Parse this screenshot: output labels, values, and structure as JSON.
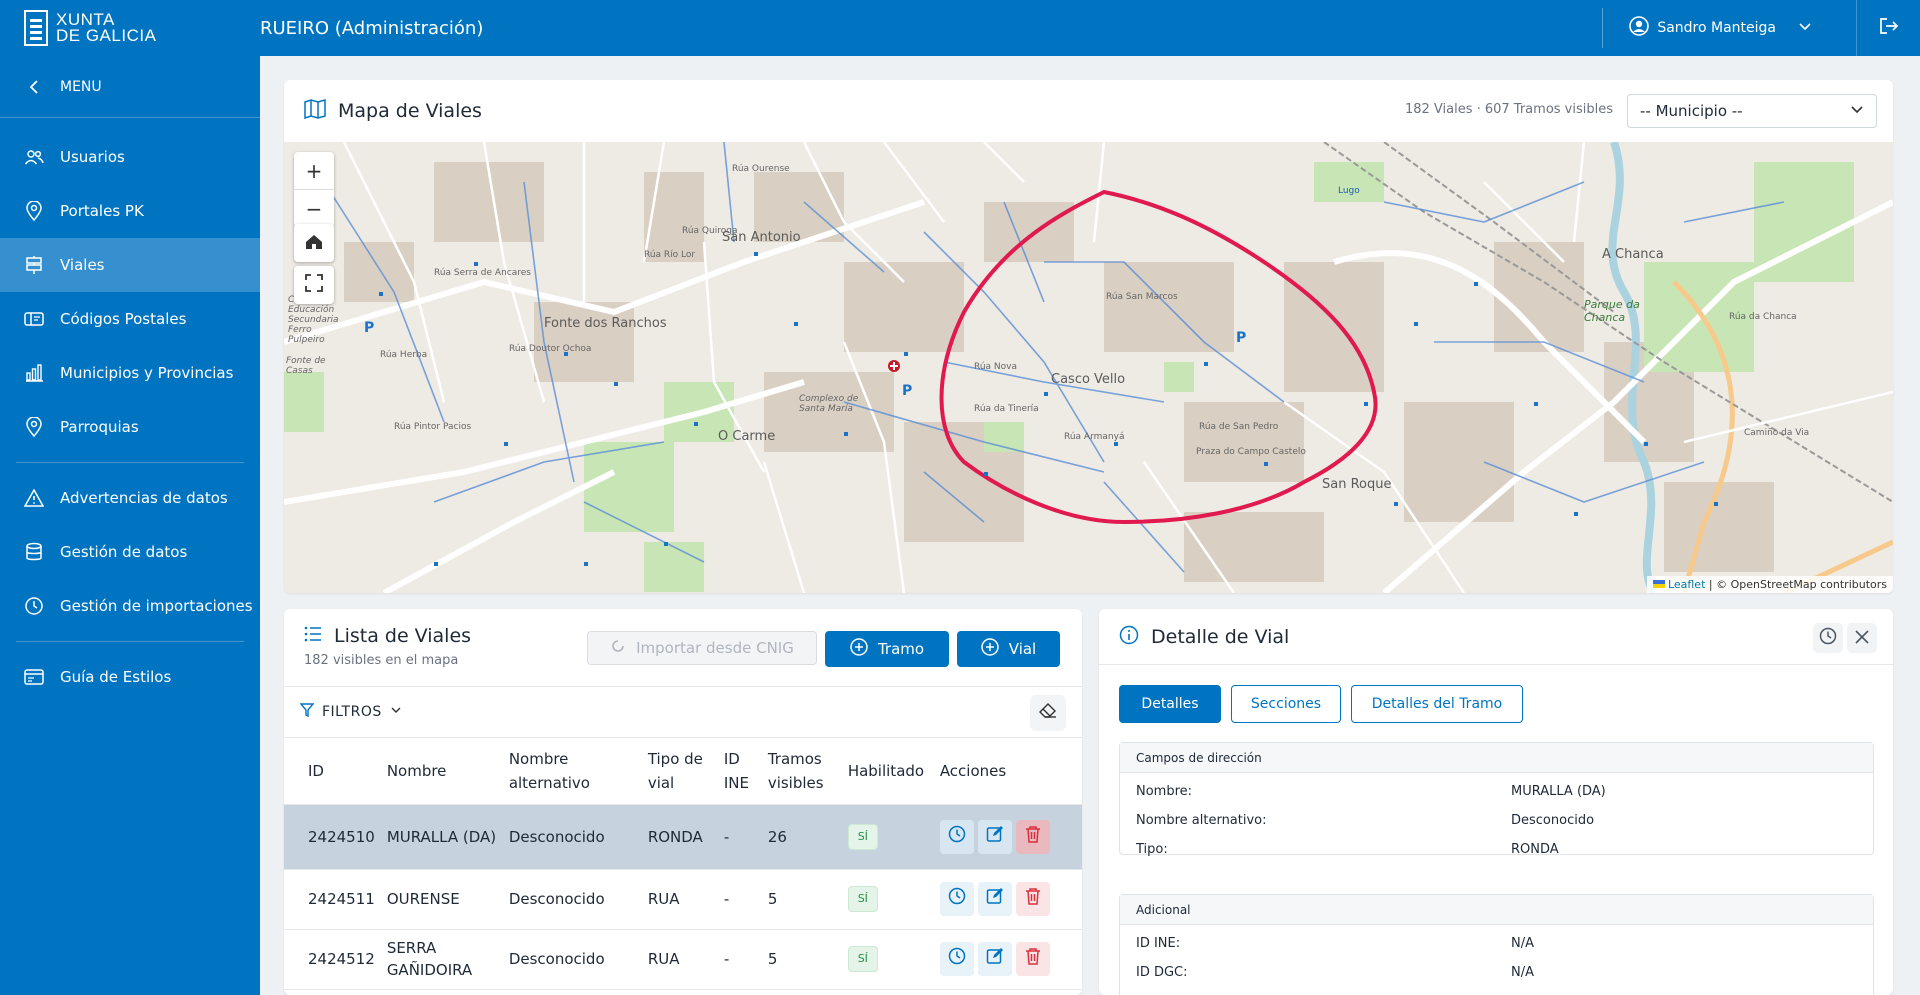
{
  "header": {
    "logo_line1": "XUNTA",
    "logo_line2": "DE GALICIA",
    "app_title": "RUEIRO (Administración)",
    "user_name": "Sandro Manteiga"
  },
  "sidebar": {
    "menu_label": "MENU",
    "items": [
      {
        "label": "Usuarios",
        "icon": "users-icon"
      },
      {
        "label": "Portales PK",
        "icon": "map-pin-icon"
      },
      {
        "label": "Viales",
        "icon": "signpost-icon"
      },
      {
        "label": "Códigos Postales",
        "icon": "mailbox-icon"
      },
      {
        "label": "Municipios y Provincias",
        "icon": "bar-chart-icon"
      },
      {
        "label": "Parroquias",
        "icon": "location-icon"
      },
      {
        "label": "Advertencias de datos",
        "icon": "warning-icon"
      },
      {
        "label": "Gestión de datos",
        "icon": "database-icon"
      },
      {
        "label": "Gestión de importaciones",
        "icon": "history-icon"
      },
      {
        "label": "Guía de Estilos",
        "icon": "browser-icon"
      }
    ],
    "active_item": "Viales"
  },
  "map_panel": {
    "title": "Mapa de Viales",
    "stats": "182 Viales · 607 Tramos visibles",
    "municipio_select": "-- Municipio --",
    "zoom_in": "+",
    "zoom_out": "−",
    "attribution_leaflet": "Leaflet",
    "attribution_rest": "| © OpenStreetMap contributors",
    "labels": {
      "san_antonio": "San Antonio",
      "fonte_dos_ranchos": "Fonte dos Ranchos",
      "o_carme": "O Carme",
      "casco_vello": "Casco Vello",
      "san_roque": "San Roque",
      "a_chanca": "A Chanca",
      "lugo": "Lugo",
      "parque_da_chanca": "Parque da Chanca",
      "complexo": "Complexo de Santa María",
      "centro_educacion": "Centro de Educación Secundaria Ferro Pulpeiro",
      "fonte_de_casas": "Fonte de Casas",
      "rua_serra_de_ancares": "Rúa Serra de Ancares",
      "rua_herba": "Rúa Herba",
      "rua_doutor_ochoa": "Rúa Doutor Ochoa",
      "rua_pintor_pacios": "Rúa Pintor Pacios",
      "rua_nova": "Rúa Nova",
      "rua_san_marcos": "Rúa San Marcos",
      "rua_da_tineria": "Rúa da Tinería",
      "rua_armanya": "Rúa Armanyá",
      "praza_do_campo_castelo": "Praza do Campo Castelo",
      "rua_de_san_pedro": "Rúa de San Pedro",
      "rua_chanca": "Rúa da Chanca",
      "camino_da_via": "Camiño da Via",
      "rua_rio_lor": "Rúa Río Lor",
      "rua_quiroga": "Rúa Quiroga",
      "rua_ourense": "Rúa Ourense"
    }
  },
  "list_panel": {
    "title": "Lista de Viales",
    "subtitle": "182 visibles en el mapa",
    "import_button": "Importar desde CNIG",
    "tramo_button": "Tramo",
    "vial_button": "Vial",
    "filters_label": "FILTROS",
    "columns": [
      "ID",
      "Nombre",
      "Nombre alternativo",
      "Tipo de vial",
      "ID INE",
      "Tramos visibles",
      "Habilitado",
      "Acciones"
    ],
    "rows": [
      {
        "id": "2424510",
        "nombre": "MURALLA (DA)",
        "alt": "Desconocido",
        "tipo": "RONDA",
        "ine": "-",
        "tramos": "26",
        "habilitado": "SÍ"
      },
      {
        "id": "2424511",
        "nombre": "OURENSE",
        "alt": "Desconocido",
        "tipo": "RUA",
        "ine": "-",
        "tramos": "5",
        "habilitado": "SÍ"
      },
      {
        "id": "2424512",
        "nombre": "SERRA GAÑIDOIRA",
        "alt": "Desconocido",
        "tipo": "RUA",
        "ine": "-",
        "tramos": "5",
        "habilitado": "SÍ"
      }
    ]
  },
  "detail_panel": {
    "title": "Detalle de Vial",
    "tabs": [
      "Detalles",
      "Secciones",
      "Detalles del Tramo"
    ],
    "active_tab": "Detalles",
    "section1": {
      "title": "Campos de dirección",
      "fields": [
        {
          "key": "Nombre:",
          "value": "MURALLA (DA)"
        },
        {
          "key": "Nombre alternativo:",
          "value": "Desconocido"
        },
        {
          "key": "Tipo:",
          "value": "RONDA"
        }
      ]
    },
    "section2": {
      "title": "Adicional",
      "fields": [
        {
          "key": "ID INE:",
          "value": "N/A"
        },
        {
          "key": "ID DGC:",
          "value": "N/A"
        }
      ]
    }
  },
  "colors": {
    "primary": "#0074c1",
    "sidebar_active": "#3690cf",
    "route_highlight": "#e0194f",
    "yes_badge": "#2a8a45",
    "delete": "#d9303e"
  }
}
